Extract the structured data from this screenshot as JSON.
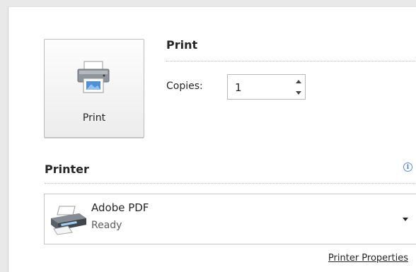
{
  "print_section": {
    "title": "Print",
    "button_label": "Print",
    "copies_label": "Copies:",
    "copies_value": "1"
  },
  "printer_section": {
    "title": "Printer",
    "info_glyph": "i",
    "selected_printer": {
      "name": "Adobe PDF",
      "status": "Ready",
      "icon": "printer-device-icon"
    },
    "properties_link": "Printer Properties"
  },
  "icons": {
    "print_button_icon": "printer-icon",
    "info_icon": "info-icon",
    "dropdown_icon": "chevron-down-icon"
  },
  "colors": {
    "background": "#e9e9e9",
    "panel": "#ffffff",
    "accent": "#3f7fcf"
  }
}
